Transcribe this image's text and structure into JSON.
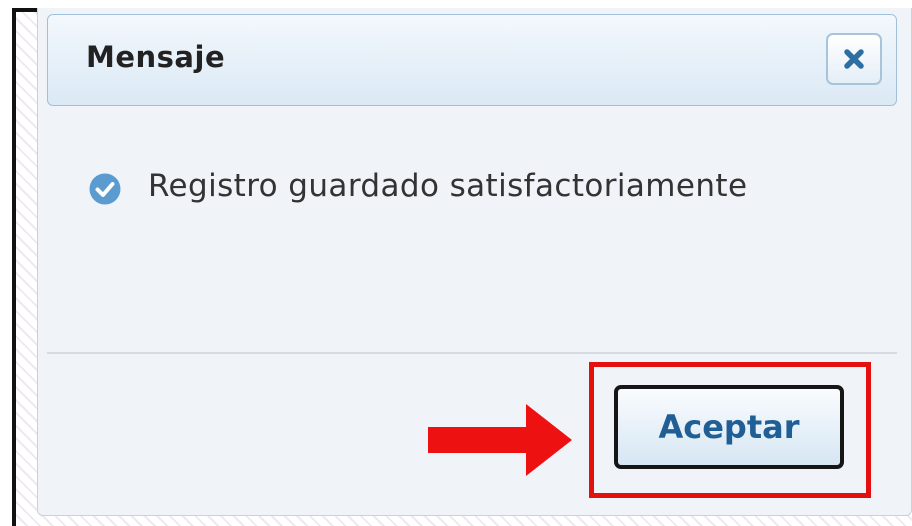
{
  "dialog": {
    "title": "Mensaje",
    "close_icon": "close-icon",
    "message": "Registro guardado satisfactoriamente",
    "message_icon": "check-circle-icon",
    "accept_label": "Aceptar"
  },
  "annotations": {
    "arrow_icon": "arrow-right-icon",
    "highlight_color": "#e41010"
  },
  "colors": {
    "title_bar_bg": "#dbe9f5",
    "dialog_bg": "#f0f3f7",
    "accent": "#1f5f96",
    "check_icon": "#5b9bd0"
  }
}
